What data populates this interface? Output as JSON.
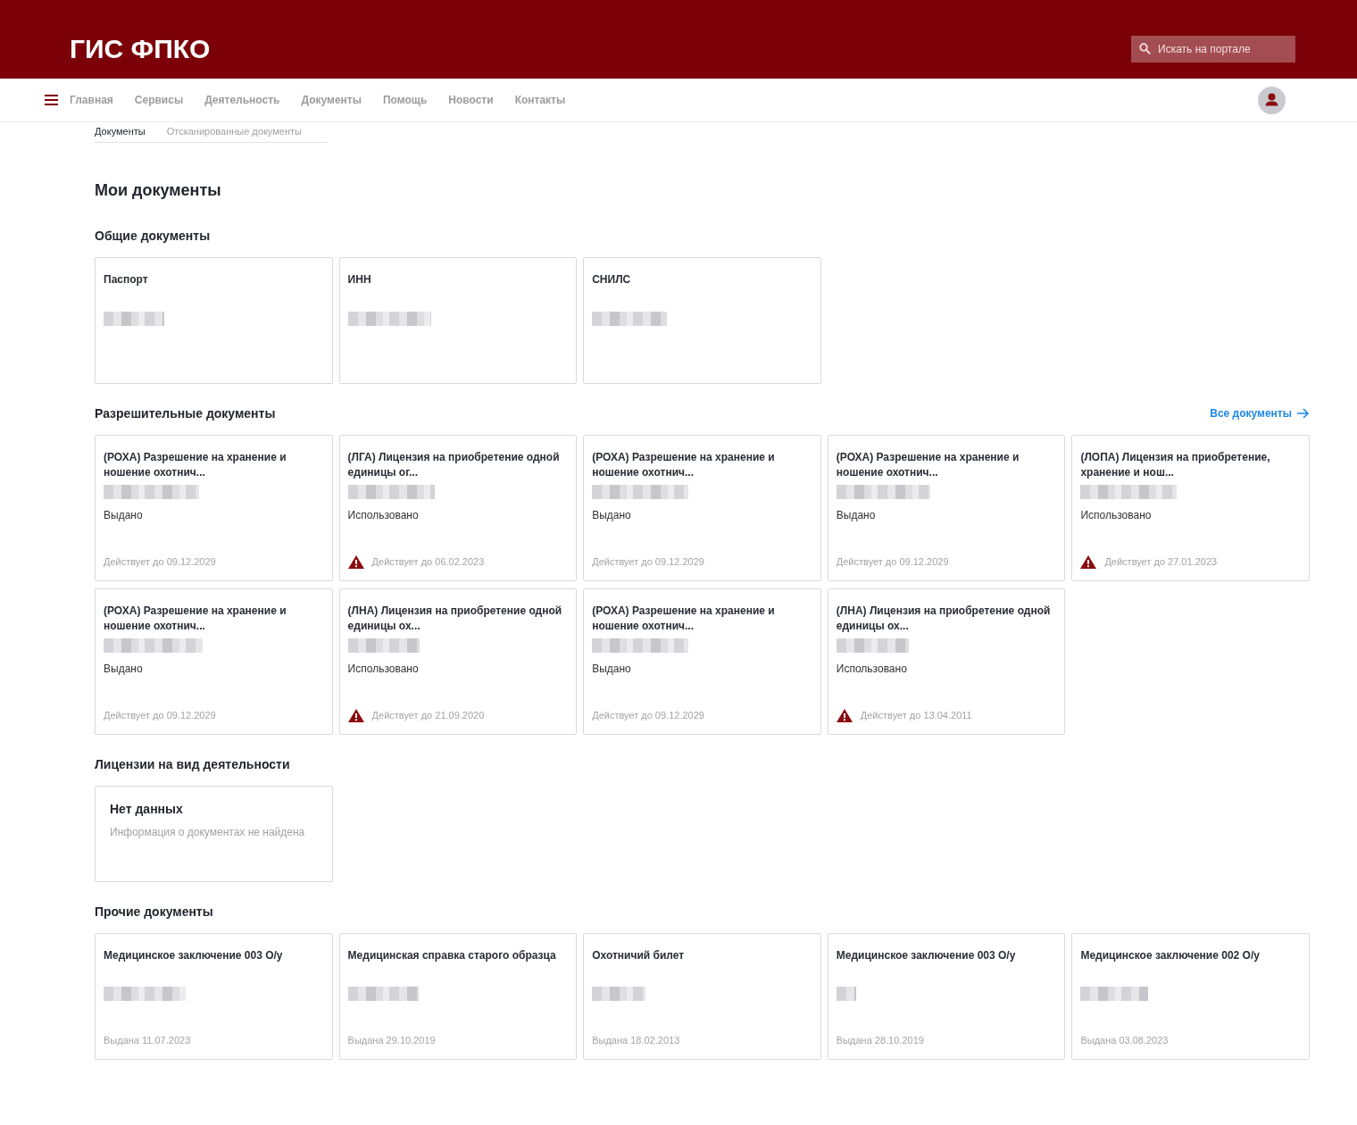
{
  "header": {
    "logo": "ГИС ФПКО",
    "search": {
      "placeholder": "Искать на портале"
    }
  },
  "nav": {
    "items": [
      {
        "label": "Главная",
        "selected": false
      },
      {
        "label": "Сервисы",
        "selected": false
      },
      {
        "label": "Деятельность",
        "selected": false
      },
      {
        "label": "Документы",
        "selected": false
      },
      {
        "label": "Помощь",
        "selected": false
      },
      {
        "label": "Новости",
        "selected": false
      },
      {
        "label": "Контакты",
        "selected": false
      }
    ]
  },
  "subtabs": [
    {
      "label": "Документы",
      "selected": true
    },
    {
      "label": "Отсканированные документы",
      "selected": false
    }
  ],
  "page_title": "Мои документы",
  "sections": [
    {
      "kind": "general",
      "title": "Общие документы",
      "cards": [
        {
          "title": "Паспорт",
          "masked": true
        },
        {
          "title": "ИНН",
          "masked": true
        },
        {
          "title": "СНИЛС",
          "masked": true
        }
      ]
    },
    {
      "kind": "permits",
      "title": "Разрешительные документы",
      "link": "Все документы",
      "cards": [
        {
          "title": "(РОХА) Разрешение на хранение и ношение охотнич...",
          "masked": true,
          "status": "Выдано",
          "validity": "Действует до 09.12.2029",
          "warning": false
        },
        {
          "title": "(ЛГА) Лицензия на приобретение одной единицы ог...",
          "masked": true,
          "status": "Использовано",
          "validity": "Действует до 06.02.2023",
          "warning": true
        },
        {
          "title": "(РОХА) Разрешение на хранение и ношение охотнич...",
          "masked": true,
          "status": "Выдано",
          "validity": "Действует до 09.12.2029",
          "warning": false
        },
        {
          "title": "(РОХА) Разрешение на хранение и ношение охотнич...",
          "masked": true,
          "status": "Выдано",
          "validity": "Действует до 09.12.2029",
          "warning": false
        },
        {
          "title": "(ЛОПА) Лицензия на приобретение, хранение и нош...",
          "masked": true,
          "status": "Использовано",
          "validity": "Действует до 27.01.2023",
          "warning": true
        },
        {
          "title": "(РОХА) Разрешение на хранение и ношение охотнич...",
          "masked": true,
          "status": "Выдано",
          "validity": "Действует до 09.12.2029",
          "warning": false
        },
        {
          "title": "(ЛНА) Лицензия на приобретение одной единицы ох...",
          "masked": true,
          "status": "Использовано",
          "validity": "Действует до 21.09.2020",
          "warning": true
        },
        {
          "title": "(РОХА) Разрешение на хранение и ношение охотнич...",
          "masked": true,
          "status": "Выдано",
          "validity": "Действует до 09.12.2029",
          "warning": false
        },
        {
          "title": "(ЛНА) Лицензия на приобретение одной единицы ох...",
          "masked": true,
          "status": "Использовано",
          "validity": "Действует до 13.04.2011",
          "warning": true
        }
      ]
    },
    {
      "kind": "empty",
      "title": "Лицензии на вид деятельности",
      "empty": {
        "title": "Нет данных",
        "text": "Информация о документах не найдена"
      }
    },
    {
      "kind": "other",
      "title": "Прочие документы",
      "cards": [
        {
          "title": "Медицинское заключение 003 О/у",
          "masked": true,
          "issued": "Выдана 11.07.2023"
        },
        {
          "title": "Медицинская справка старого образца",
          "masked": true,
          "issued": "Выдана 29.10.2019"
        },
        {
          "title": "Охотничий билет",
          "masked": true,
          "issued": "Выдана 18.02.2013"
        },
        {
          "title": "Медицинское заключение 003 О/у",
          "masked": true,
          "issued": "Выдана 28.10.2019"
        },
        {
          "title": "Медицинское заключение 002 О/у",
          "masked": true,
          "issued": "Выдана 03.08.2023"
        }
      ]
    }
  ]
}
